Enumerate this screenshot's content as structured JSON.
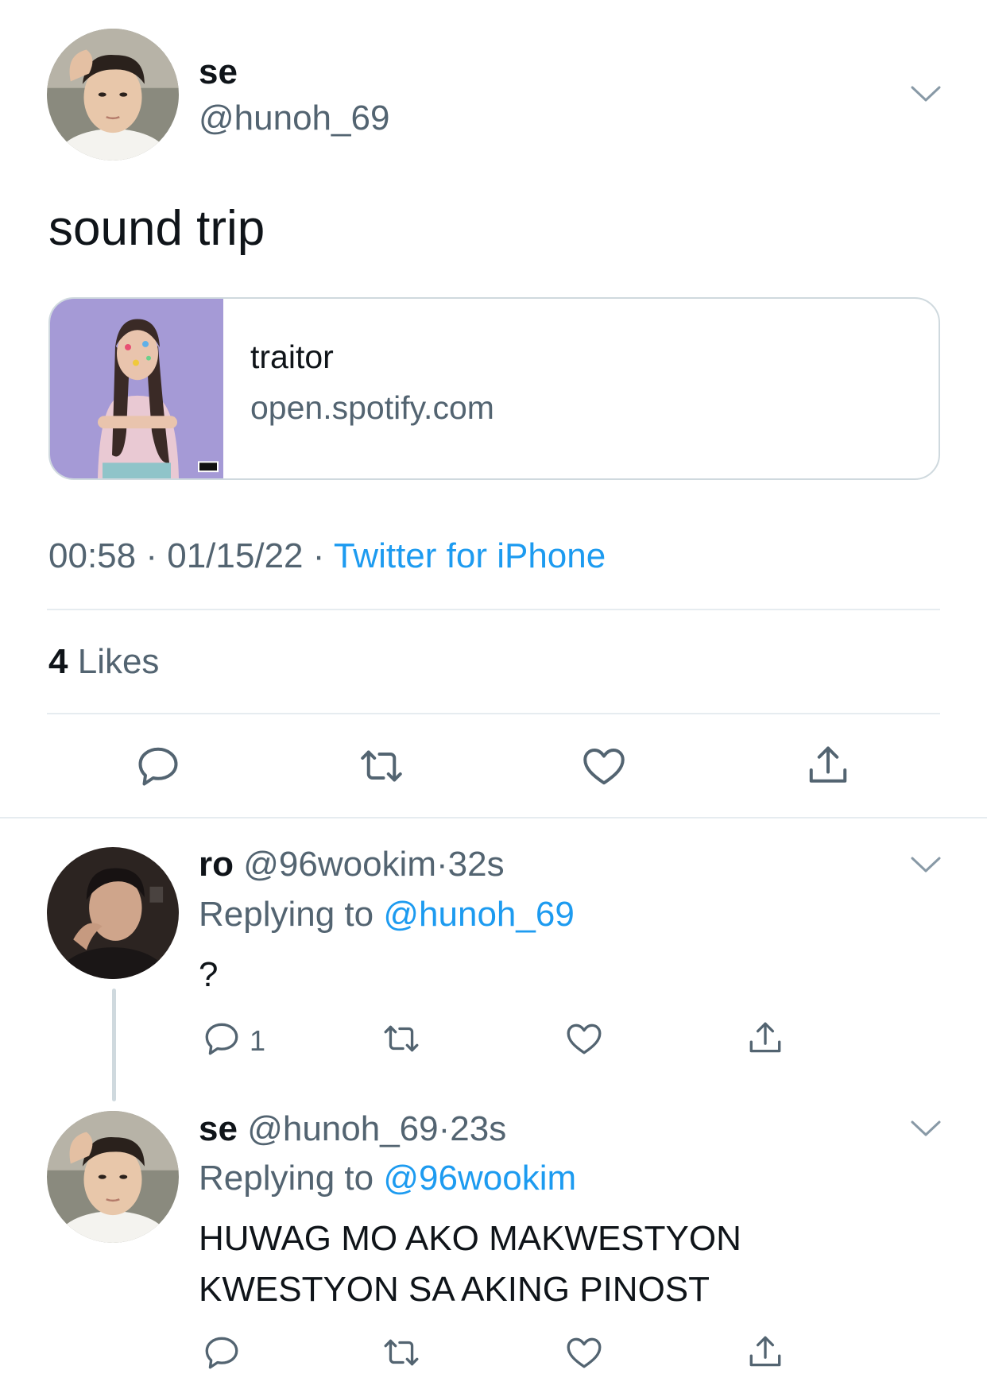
{
  "main_tweet": {
    "author_name": "se",
    "author_handle": "@hunoh_69",
    "text": "sound trip",
    "card": {
      "title": "traitor",
      "domain": "open.spotify.com"
    },
    "time": "00:58",
    "date": "01/15/22",
    "source": "Twitter for iPhone",
    "likes_count": "4",
    "likes_label": "Likes",
    "icons": [
      "reply-icon",
      "retweet-icon",
      "like-icon",
      "share-icon",
      "chevron-down-icon"
    ]
  },
  "replies": [
    {
      "author_name": "ro",
      "author_handle": "@96wookim",
      "separator": "·",
      "time": "32s",
      "replying_label": "Replying to",
      "replying_to": "@hunoh_69",
      "text": "?",
      "reply_count": "1"
    },
    {
      "author_name": "se",
      "author_handle": "@hunoh_69",
      "separator": "·",
      "time": "23s",
      "replying_label": "Replying to",
      "replying_to": "@96wookim",
      "text_line1": "HUWAG MO AKO MAKWESTYON",
      "text_line2": "KWESTYON SA AKING PINOST"
    }
  ],
  "colors": {
    "accent": "#1d9bf0",
    "secondary_text": "#536471",
    "primary_text": "#0f1419",
    "divider": "#e6ecf0"
  }
}
